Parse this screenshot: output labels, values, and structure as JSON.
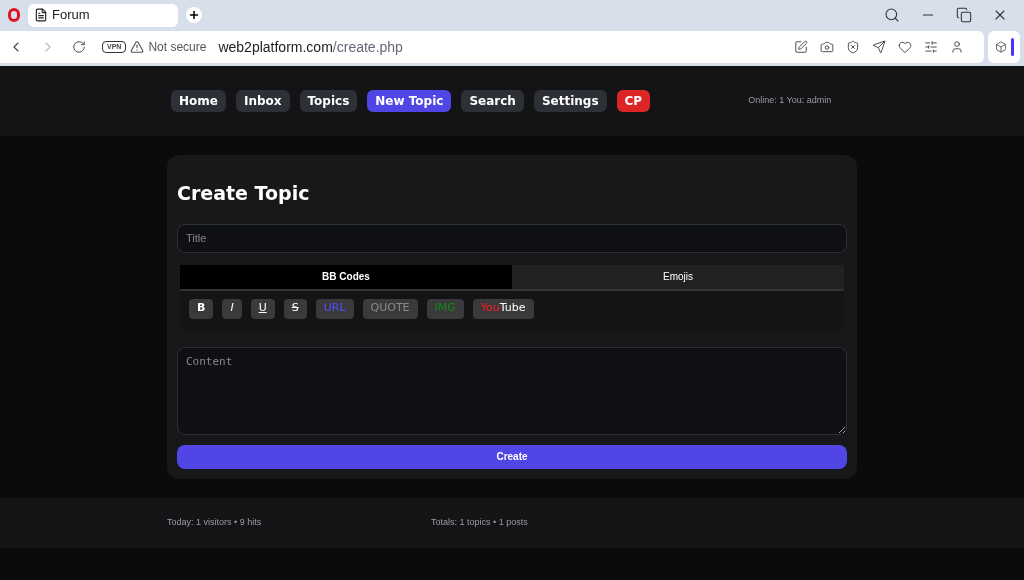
{
  "browser": {
    "tab_title": "Forum",
    "vpn": "VPN",
    "security": "Not secure",
    "url_host": "web2platform.com",
    "url_path": "/create.php"
  },
  "nav": [
    {
      "label": "Home",
      "kind": "normal",
      "selected": false
    },
    {
      "label": "Inbox",
      "kind": "normal",
      "selected": false
    },
    {
      "label": "Topics",
      "kind": "normal",
      "selected": false
    },
    {
      "label": "New Topic",
      "kind": "normal",
      "selected": true
    },
    {
      "label": "Search",
      "kind": "normal",
      "selected": false
    },
    {
      "label": "Settings",
      "kind": "normal",
      "selected": false
    },
    {
      "label": "CP",
      "kind": "admin",
      "selected": false
    }
  ],
  "online": "Online: 1 You: admin",
  "heading": "Create Topic",
  "title_field": {
    "placeholder": "Title"
  },
  "editor_tabs": [
    {
      "label": "BB Codes",
      "selected": true
    },
    {
      "label": "Emojis",
      "selected": false
    }
  ],
  "bbcodes": [
    {
      "kind": "bold",
      "label": "B"
    },
    {
      "kind": "italic",
      "label": "I"
    },
    {
      "kind": "underline",
      "label": "U"
    },
    {
      "kind": "strike",
      "label": "S"
    },
    {
      "kind": "url",
      "label": "URL"
    },
    {
      "kind": "quote",
      "label": "QUOTE"
    },
    {
      "kind": "img",
      "label": "IMG"
    },
    {
      "kind": "youtube",
      "parts": [
        "You",
        "Tube"
      ]
    }
  ],
  "content_field": {
    "placeholder": "Content"
  },
  "submit": "Create",
  "footer": {
    "today": "Today: 1 visitors • 9 hits",
    "totals": "Totals: 1 topics • 1 posts"
  }
}
